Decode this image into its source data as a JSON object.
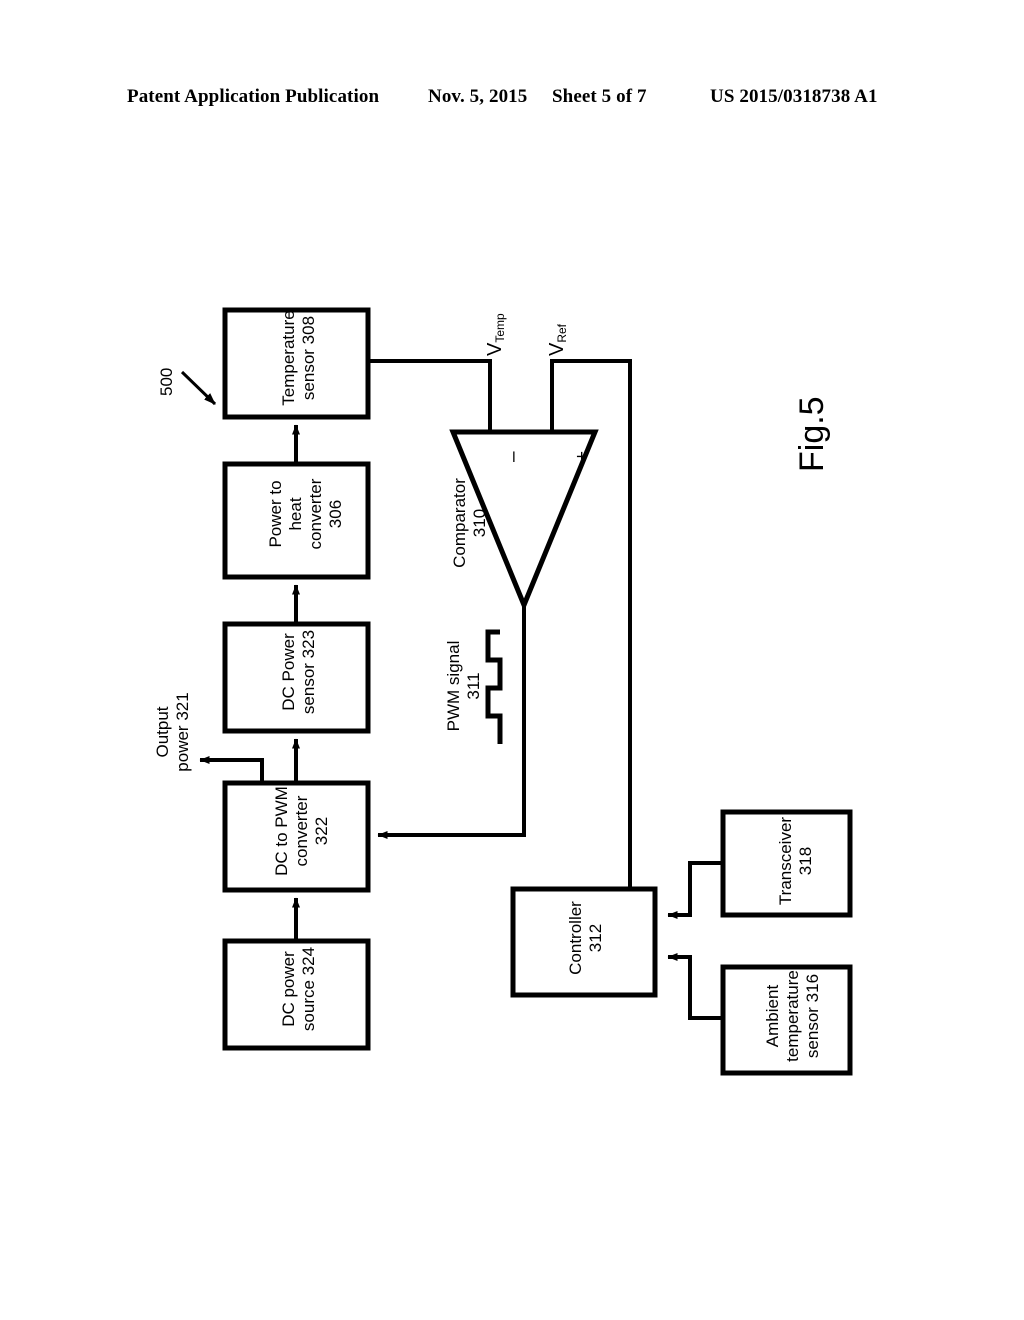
{
  "header": {
    "publication": "Patent Application Publication",
    "date": "Nov. 5, 2015",
    "sheet": "Sheet 5 of 7",
    "doc_number": "US 2015/0318738 A1"
  },
  "figure": {
    "title": "Fig.5",
    "system_reference": "500",
    "blocks": [
      {
        "id": "temperature-sensor",
        "label": "Temperature\nsensor 308",
        "line1": "Temperature",
        "line2": "sensor 308"
      },
      {
        "id": "power-to-heat-converter",
        "label": "Power to\nheat\nconverter\n306",
        "line1": "Power to",
        "line2": "heat",
        "line3": "converter",
        "line4": "306"
      },
      {
        "id": "dc-power-sensor",
        "label": "DC Power\nsensor 323",
        "line1": "DC Power",
        "line2": "sensor 323"
      },
      {
        "id": "dc-to-pwm-converter",
        "label": "DC to PWM\nconverter\n322",
        "line1": "DC to PWM",
        "line2": "converter",
        "line3": "322"
      },
      {
        "id": "dc-power-source",
        "label": "DC power\nsource 324",
        "line1": "DC power",
        "line2": "source 324"
      },
      {
        "id": "controller",
        "label": "Controller\n312",
        "line1": "Controller",
        "line2": "312"
      },
      {
        "id": "transceiver",
        "label": "Transceiver\n318",
        "line1": "Transceiver",
        "line2": "318"
      },
      {
        "id": "ambient-temperature-sensor",
        "label": "Ambient\ntemperature\nsensor 316",
        "line1": "Ambient",
        "line2": "temperature",
        "line3": "sensor 316"
      }
    ],
    "comparator": {
      "name": "Comparator",
      "number": "310",
      "minus_input": "–",
      "plus_input": "+"
    },
    "signals": {
      "v_temp_base": "V",
      "v_temp_sub": "Temp",
      "v_ref_base": "V",
      "v_ref_sub": "Ref",
      "pwm_name": "PWM signal",
      "pwm_number": "311",
      "output_power_line1": "Output",
      "output_power_line2": "power 321"
    },
    "colors": {
      "stroke": "#000000",
      "background": "#ffffff"
    }
  }
}
